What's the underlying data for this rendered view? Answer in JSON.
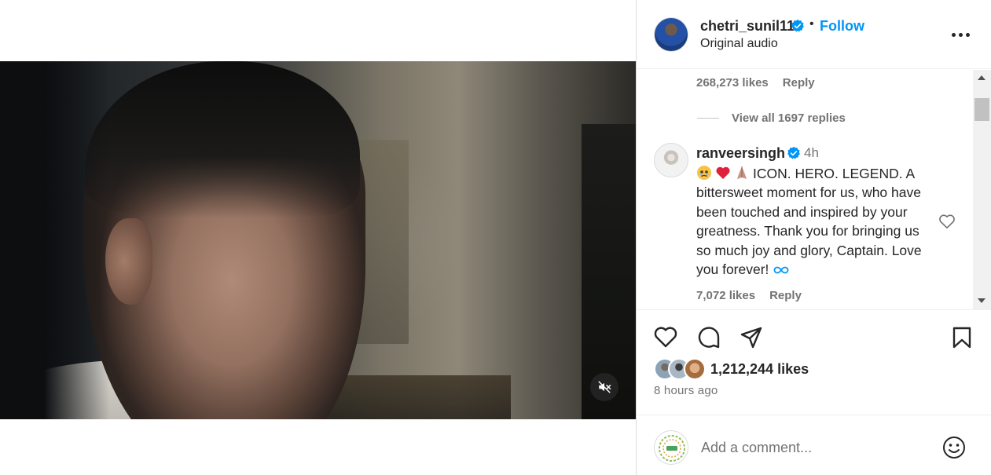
{
  "post": {
    "username": "chetri_sunil11",
    "separator": "•",
    "follow_label": "Follow",
    "audio": "Original audio"
  },
  "comments": {
    "prev": {
      "likes": "268,273 likes",
      "reply_label": "Reply"
    },
    "view_replies": "View all 1697 replies",
    "main": {
      "username": "ranveersingh",
      "time": "4h",
      "text": "ICON. HERO. LEGEND. A bittersweet moment for us, who have been touched and inspired by your greatness. Thank you for bringing us so much joy and glory, Captain. Love you forever!",
      "likes": "7,072 likes",
      "reply_label": "Reply",
      "emojis": [
        "face-holding-back-tears",
        "red-heart",
        "folded-hands"
      ]
    }
  },
  "engagement": {
    "likes": "1,212,244 likes",
    "time_ago": "8 hours ago"
  },
  "composer": {
    "placeholder": "Add a comment..."
  },
  "colors": {
    "accent": "#0095f6",
    "verified": "#0095f6",
    "text": "#262626",
    "muted": "#737373"
  },
  "icons": [
    "mute-icon",
    "verified-icon",
    "more-icon",
    "heart-icon",
    "comment-icon",
    "share-icon",
    "bookmark-icon",
    "emoji-icon",
    "loop-icon"
  ]
}
